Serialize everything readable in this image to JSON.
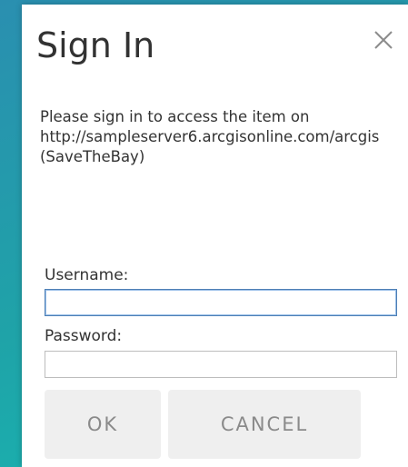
{
  "dialog": {
    "title": "Sign In",
    "close_icon": "close-icon",
    "message": "Please sign in to access the item on http://sampleserver6.arcgisonline.com/arcgis (SaveTheBay)",
    "username": {
      "label": "Username:",
      "value": "",
      "placeholder": ""
    },
    "password": {
      "label": "Password:",
      "value": "",
      "placeholder": ""
    },
    "buttons": {
      "ok": "OK",
      "cancel": "CANCEL"
    }
  },
  "colors": {
    "background_start": "#2a8fb0",
    "background_end": "#17b7b2",
    "dialog_bg": "#ffffff",
    "button_bg": "#efefef",
    "button_text": "#8a8a8a",
    "focus_border": "#4d7fb5"
  }
}
